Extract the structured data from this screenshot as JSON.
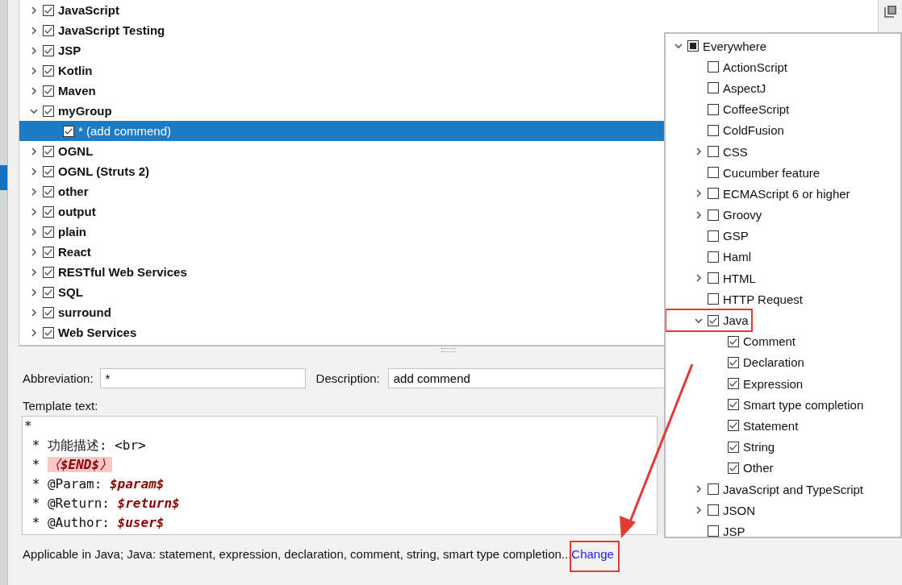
{
  "templates": [
    {
      "label": "JavaScript",
      "checked": true,
      "expanded": false,
      "selected": false
    },
    {
      "label": "JavaScript Testing",
      "checked": true,
      "expanded": false,
      "selected": false
    },
    {
      "label": "JSP",
      "checked": true,
      "expanded": false,
      "selected": false
    },
    {
      "label": "Kotlin",
      "checked": true,
      "expanded": false,
      "selected": false
    },
    {
      "label": "Maven",
      "checked": true,
      "expanded": false,
      "selected": false
    },
    {
      "label": "myGroup",
      "checked": true,
      "expanded": true,
      "selected": false,
      "children": [
        {
          "label": "* (add commend)",
          "checked": true,
          "selected": true
        }
      ]
    },
    {
      "label": "OGNL",
      "checked": true,
      "expanded": false,
      "selected": false
    },
    {
      "label": "OGNL (Struts 2)",
      "checked": true,
      "expanded": false,
      "selected": false
    },
    {
      "label": "other",
      "checked": true,
      "expanded": false,
      "selected": false
    },
    {
      "label": "output",
      "checked": true,
      "expanded": false,
      "selected": false
    },
    {
      "label": "plain",
      "checked": true,
      "expanded": false,
      "selected": false
    },
    {
      "label": "React",
      "checked": true,
      "expanded": false,
      "selected": false
    },
    {
      "label": "RESTful Web Services",
      "checked": true,
      "expanded": false,
      "selected": false
    },
    {
      "label": "SQL",
      "checked": true,
      "expanded": false,
      "selected": false
    },
    {
      "label": "surround",
      "checked": true,
      "expanded": false,
      "selected": false
    },
    {
      "label": "Web Services",
      "checked": true,
      "expanded": false,
      "selected": false
    }
  ],
  "abbreviation": {
    "label": "Abbreviation:",
    "value": "*"
  },
  "description": {
    "label": "Description:",
    "value": "add commend"
  },
  "template_text": {
    "label": "Template text:",
    "lines": [
      [
        {
          "text": "*",
          "kind": "plain"
        }
      ],
      [
        {
          "text": " * 功能描述: <br>",
          "kind": "plain"
        }
      ],
      [
        {
          "text": " * ",
          "kind": "plain"
        },
        {
          "text": "〈$END$〉",
          "kind": "end"
        }
      ],
      [
        {
          "text": " * @Param: ",
          "kind": "plain"
        },
        {
          "text": "$param$",
          "kind": "var"
        }
      ],
      [
        {
          "text": " * @Return: ",
          "kind": "plain"
        },
        {
          "text": "$return$",
          "kind": "var"
        }
      ],
      [
        {
          "text": " * @Author: ",
          "kind": "plain"
        },
        {
          "text": "$user$",
          "kind": "var"
        }
      ]
    ]
  },
  "applicable": {
    "text": "Applicable in Java; Java: statement, expression, declaration, comment, string, smart type completion...",
    "link": "Change",
    "annotated": true
  },
  "contexts": [
    {
      "label": "Everywhere",
      "checked": false,
      "partial": true,
      "expanded": true,
      "children": [
        {
          "label": "ActionScript",
          "checked": false
        },
        {
          "label": "AspectJ",
          "checked": false
        },
        {
          "label": "CoffeeScript",
          "checked": false
        },
        {
          "label": "ColdFusion",
          "checked": false
        },
        {
          "label": "CSS",
          "checked": false,
          "expanded": false
        },
        {
          "label": "Cucumber feature",
          "checked": false
        },
        {
          "label": "ECMAScript 6 or higher",
          "checked": false,
          "expanded": false
        },
        {
          "label": "Groovy",
          "checked": false,
          "expanded": false
        },
        {
          "label": "GSP",
          "checked": false
        },
        {
          "label": "Haml",
          "checked": false
        },
        {
          "label": "HTML",
          "checked": false,
          "expanded": false
        },
        {
          "label": "HTTP Request",
          "checked": false
        },
        {
          "label": "Java",
          "checked": true,
          "expanded": true,
          "annotated": true,
          "children": [
            {
              "label": "Comment",
              "checked": true
            },
            {
              "label": "Declaration",
              "checked": true
            },
            {
              "label": "Expression",
              "checked": true
            },
            {
              "label": "Smart type completion",
              "checked": true
            },
            {
              "label": "Statement",
              "checked": true
            },
            {
              "label": "String",
              "checked": true
            },
            {
              "label": "Other",
              "checked": true
            }
          ]
        },
        {
          "label": "JavaScript and TypeScript",
          "checked": false,
          "expanded": false
        },
        {
          "label": "JSON",
          "checked": false,
          "expanded": false
        },
        {
          "label": "JSP",
          "checked": false
        }
      ]
    }
  ]
}
